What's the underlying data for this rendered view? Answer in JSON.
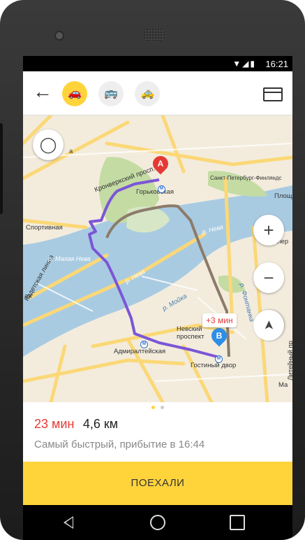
{
  "status_bar": {
    "time": "16:21",
    "icons_text": "▼◢▮"
  },
  "toolbar": {
    "back_icon": "←",
    "modes": [
      {
        "name": "car",
        "icon": "🚗",
        "active": true
      },
      {
        "name": "bus",
        "icon": "🚌",
        "active": false
      },
      {
        "name": "taxi",
        "icon": "🚕",
        "active": false
      }
    ]
  },
  "map": {
    "labels": {
      "gorkovskaya": "Горьковская",
      "kronverksky": "Кронверкский просп.",
      "sportivnaya": "Спортивная",
      "finland_station": "Санкт-Петербург-Финляндс",
      "plosh": "Площ",
      "nevsky_prospekt": "Невский проспект",
      "admiralteyskaya": "Адмиралтейская",
      "gostiny_dvor": "Гостиный двор",
      "kadetskaya": "Кадетская линия",
      "litey": "Литейный пр",
      "ma": "Ма",
      "aya": "ая",
      "ler": "лер",
      "a_left": "а",
      "reka_neva_1": "р. Нева",
      "reka_neva_2": "р. Нева",
      "malaya_neva": "р. Малая Нева",
      "moika": "р. Мойка",
      "fontanka": "р. Фонтанка"
    },
    "pin_a": "A",
    "pin_b": "B",
    "metro_symbol": "M",
    "delay_badge": "+3 мин",
    "zoom_in": "+",
    "zoom_out": "−",
    "locate_icon": "➤",
    "compass_icon": "◯",
    "colors": {
      "route_main": "#7c56d6",
      "route_alt": "#8c7b6a",
      "water": "#a9cbe2",
      "park": "#c4dca4",
      "road": "#fbd877"
    }
  },
  "route": {
    "duration": "23 мин",
    "distance": "4,6 км",
    "description": "Самый быстрый, прибытие в 16:44"
  },
  "go_button": "ПОЕХАЛИ",
  "accent_color": "#ffd43b"
}
